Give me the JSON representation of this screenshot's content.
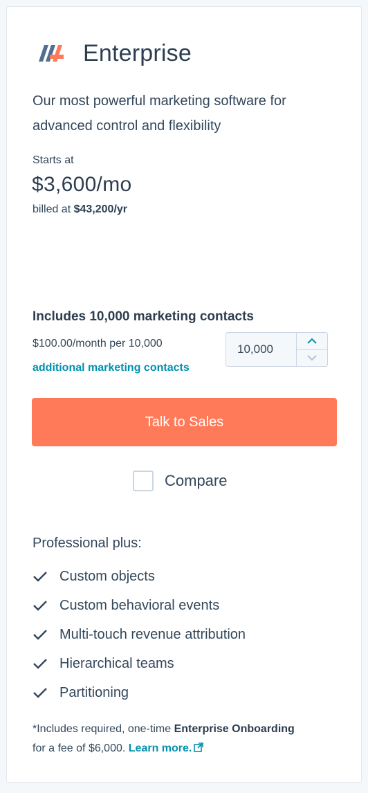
{
  "plan": {
    "name": "Enterprise",
    "description": "Our most powerful marketing software for advanced control and flexibility",
    "starts_label": "Starts at",
    "price": "$3,600/mo",
    "billed_prefix": "billed at",
    "billed_amount": "$43,200/yr"
  },
  "contacts": {
    "includes": "Includes 10,000 marketing contacts",
    "rate": "$100.00/month per 10,000",
    "additional": "additional marketing contacts",
    "stepper_value": "10,000"
  },
  "cta": {
    "label": "Talk to Sales"
  },
  "compare": {
    "label": "Compare",
    "checked": false
  },
  "features": {
    "heading": "Professional plus:",
    "items": [
      "Custom objects",
      "Custom behavioral events",
      "Multi-touch revenue attribution",
      "Hierarchical teams",
      "Partitioning"
    ]
  },
  "footnote": {
    "prefix": "*Includes required, one-time",
    "bold": "Enterprise Onboarding",
    "suffix": "for a fee of $6,000.",
    "link": "Learn more."
  },
  "icons": {
    "logo": "hubspot-sprocket-logo-icon",
    "check": "checkmark-icon",
    "up": "chevron-up-icon",
    "down": "chevron-down-icon",
    "external": "external-link-icon"
  },
  "colors": {
    "accent": "#ff7a59",
    "link": "#0091ae",
    "text": "#33475b",
    "heading": "#2d3e50"
  }
}
